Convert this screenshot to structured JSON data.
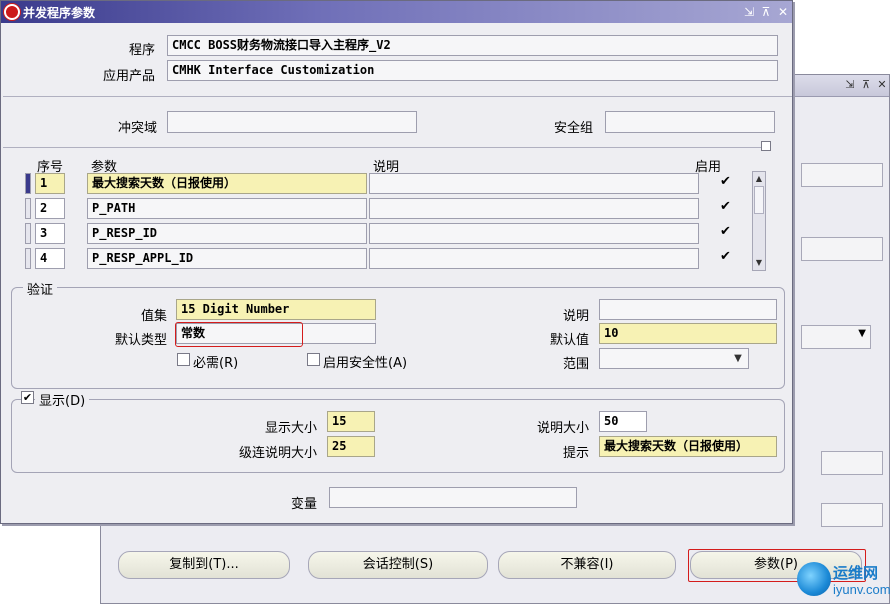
{
  "window": {
    "title": "并发程序参数"
  },
  "header": {
    "program_label": "程序",
    "program_value": "CMCC BOSS财务物流接口导入主程序_V2",
    "app_label": "应用产品",
    "app_value": "CMHK Interface Customization"
  },
  "conflict": {
    "label": "冲突域",
    "value": "",
    "security_label": "安全组",
    "security_value": ""
  },
  "table": {
    "headers": {
      "seq": "序号",
      "param": "参数",
      "desc": "说明",
      "enabled": "启用"
    },
    "rows": [
      {
        "seq": "1",
        "param": "最大搜索天数（日报使用）",
        "desc": "",
        "enabled": "✔"
      },
      {
        "seq": "2",
        "param": "P_PATH",
        "desc": "",
        "enabled": "✔"
      },
      {
        "seq": "3",
        "param": "P_RESP_ID",
        "desc": "",
        "enabled": "✔"
      },
      {
        "seq": "4",
        "param": "P_RESP_APPL_ID",
        "desc": "",
        "enabled": "✔"
      }
    ]
  },
  "validation": {
    "group_title": "验证",
    "valueset_label": "值集",
    "valueset_value": "15 Digit Number",
    "default_type_label": "默认类型",
    "default_type_value": "常数",
    "desc_label": "说明",
    "desc_value": "",
    "default_value_label": "默认值",
    "default_value_value": "10",
    "required_label": "必需(R)",
    "enable_security_label": "启用安全性(A)",
    "range_label": "范围",
    "range_value": ""
  },
  "display": {
    "group_title": "显示(D)",
    "checked": "✔",
    "display_size_label": "显示大小",
    "display_size_value": "15",
    "cascade_size_label": "级连说明大小",
    "cascade_size_value": "25",
    "desc_size_label": "说明大小",
    "desc_size_value": "50",
    "prompt_label": "提示",
    "prompt_value": "最大搜索天数（日报使用）"
  },
  "variable": {
    "label": "变量",
    "value": ""
  },
  "buttons": {
    "copy_to": "复制到(T)...",
    "session_control": "会话控制(S)",
    "incompatible": "不兼容(I)",
    "params": "参数(P)"
  },
  "watermark": {
    "line1": "运维网",
    "line2": "iyunv.com"
  },
  "colors": {
    "title_bar": "#3a3a8c",
    "required_field": "#f7f2b4",
    "highlight_box": "#d41c1c"
  }
}
